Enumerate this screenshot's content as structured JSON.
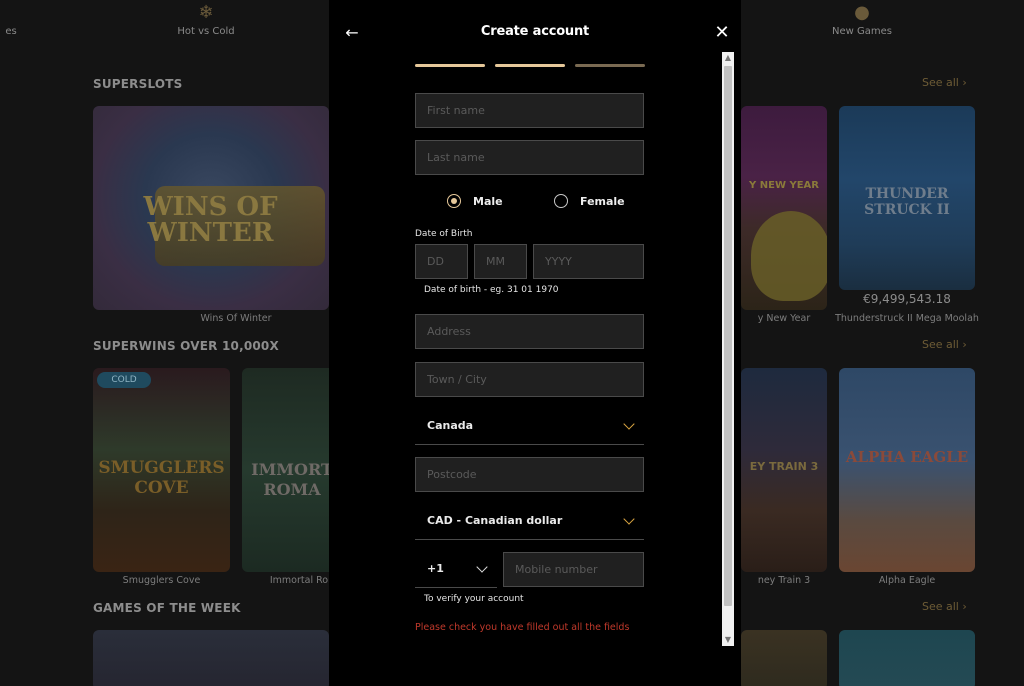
{
  "background": {
    "nav": [
      {
        "label": "es",
        "glyph": ""
      },
      {
        "label": "Hot vs Cold",
        "glyph": "❄"
      },
      {
        "label": "",
        "glyph": "⌂"
      },
      {
        "label": "",
        "glyph": "☆"
      },
      {
        "label": "New Games",
        "glyph": "●"
      }
    ],
    "sections": [
      {
        "title": "SUPERSLOTS",
        "see_all": "See all"
      },
      {
        "title": "SUPERWINS OVER 10,000X",
        "see_all": "See all"
      },
      {
        "title": "GAMES OF THE WEEK",
        "see_all": "See all"
      }
    ],
    "tiles": {
      "wins_of_winter": {
        "caption": "Wins Of Winter",
        "logo": "WINS OF WINTER"
      },
      "new_year": {
        "caption": "y New Year",
        "logo": "Y NEW YEAR"
      },
      "thunderstruck": {
        "caption": "Thunderstruck II Mega Moolah",
        "logo": "THUNDER STRUCK II",
        "jackpot": "€9,499,543.18"
      },
      "smugglers": {
        "caption": "Smugglers Cove",
        "logo": "SMUGGLERS COVE",
        "badge": "COLD"
      },
      "immortal": {
        "caption": "Immortal Ron",
        "logo": "IMMORT ROMA"
      },
      "money_train": {
        "caption": "ney Train 3",
        "logo": "EY TRAIN 3"
      },
      "alpha_eagle": {
        "caption": "Alpha Eagle",
        "logo": "ALPHA EAGLE"
      }
    }
  },
  "modal": {
    "title": "Create account",
    "back_icon": "arrow-left-icon",
    "close_icon": "close-icon",
    "steps": [
      {
        "state": "complete",
        "color": "#e6c89a"
      },
      {
        "state": "complete",
        "color": "#e6c89a"
      },
      {
        "state": "pending",
        "color": "#7a6a52"
      }
    ],
    "first_name": {
      "placeholder": "First name",
      "value": ""
    },
    "last_name": {
      "placeholder": "Last name",
      "value": ""
    },
    "gender": {
      "options": [
        {
          "label": "Male",
          "checked": true
        },
        {
          "label": "Female",
          "checked": false
        }
      ]
    },
    "dob": {
      "label": "Date of Birth",
      "day_placeholder": "DD",
      "month_placeholder": "MM",
      "year_placeholder": "YYYY",
      "hint": "Date of birth - eg. 31 01 1970"
    },
    "address": {
      "placeholder": "Address",
      "value": ""
    },
    "town": {
      "placeholder": "Town / City",
      "value": ""
    },
    "country": {
      "selected": "Canada"
    },
    "postcode": {
      "placeholder": "Postcode",
      "value": ""
    },
    "currency": {
      "selected": "CAD - Canadian dollar"
    },
    "phone": {
      "code": "+1",
      "placeholder": "Mobile number",
      "hint": "To verify your account"
    },
    "error": "Please check you have filled out all the fields"
  },
  "colors": {
    "accent": "#e6c89a",
    "chevron": "#d9a441",
    "error": "#c0392b"
  }
}
